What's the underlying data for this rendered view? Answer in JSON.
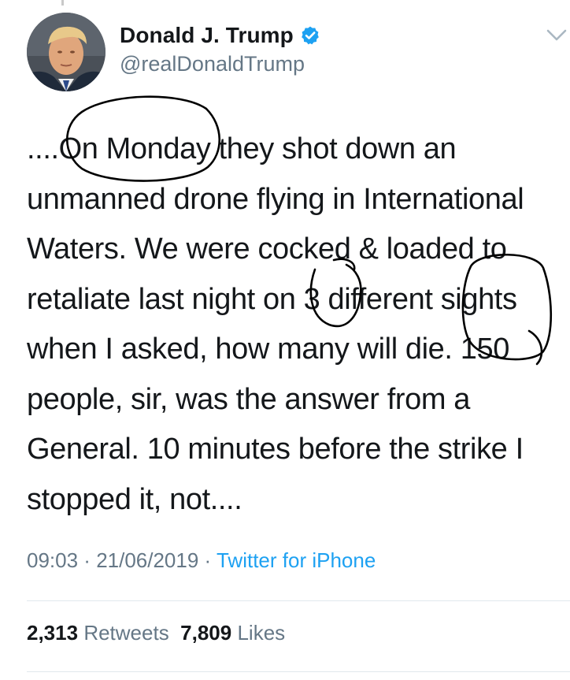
{
  "author": {
    "display_name": "Donald J. Trump",
    "handle": "@realDonaldTrump",
    "verified": true,
    "verified_icon": "verified-badge-icon",
    "accent_color": "#1da1f2"
  },
  "menu_icon": "chevron-down-icon",
  "tweet": {
    "lines": [
      "....On Monday they shot down an",
      "unmanned drone flying in International",
      "Waters. We were cocked & loaded to",
      "retaliate last night on 3 different sights",
      "when I asked, how many will die. 150",
      "people, sir, was the answer from a",
      "General. 10 minutes before the strike I",
      "stopped it, not...."
    ]
  },
  "meta": {
    "time": "09:03",
    "separator": " · ",
    "date": "21/06/2019",
    "source": "Twitter for iPhone"
  },
  "stats": {
    "retweets_count": "2,313",
    "retweets_label": "Retweets",
    "likes_count": "7,809",
    "likes_label": "Likes"
  }
}
